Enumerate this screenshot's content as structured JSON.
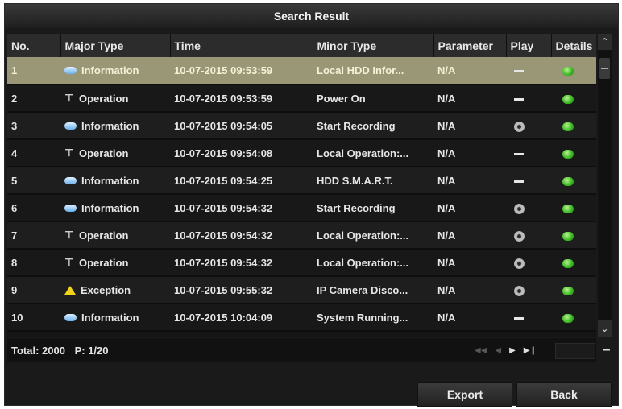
{
  "window": {
    "title": "Search Result"
  },
  "columns": [
    "No.",
    "Major Type",
    "Time",
    "Minor Type",
    "Parameter",
    "Play",
    "Details"
  ],
  "rows": [
    {
      "no": "1",
      "major": "Information",
      "major_icon": "info-cloud-icon",
      "time": "10-07-2015 09:53:59",
      "minor": "Local HDD Infor...",
      "param": "N/A",
      "play": "dash",
      "selected": true
    },
    {
      "no": "2",
      "major": "Operation",
      "major_icon": "operation-icon",
      "time": "10-07-2015 09:53:59",
      "minor": "Power On",
      "param": "N/A",
      "play": "dash",
      "selected": false
    },
    {
      "no": "3",
      "major": "Information",
      "major_icon": "info-cloud-icon",
      "time": "10-07-2015 09:54:05",
      "minor": "Start Recording",
      "param": "N/A",
      "play": "camera",
      "selected": false
    },
    {
      "no": "4",
      "major": "Operation",
      "major_icon": "operation-icon",
      "time": "10-07-2015 09:54:08",
      "minor": "Local Operation:...",
      "param": "N/A",
      "play": "dash",
      "selected": false
    },
    {
      "no": "5",
      "major": "Information",
      "major_icon": "info-cloud-icon",
      "time": "10-07-2015 09:54:25",
      "minor": "HDD S.M.A.R.T.",
      "param": "N/A",
      "play": "dash",
      "selected": false
    },
    {
      "no": "6",
      "major": "Information",
      "major_icon": "info-cloud-icon",
      "time": "10-07-2015 09:54:32",
      "minor": "Start Recording",
      "param": "N/A",
      "play": "camera",
      "selected": false
    },
    {
      "no": "7",
      "major": "Operation",
      "major_icon": "operation-icon",
      "time": "10-07-2015 09:54:32",
      "minor": "Local Operation:...",
      "param": "N/A",
      "play": "camera",
      "selected": false
    },
    {
      "no": "8",
      "major": "Operation",
      "major_icon": "operation-icon",
      "time": "10-07-2015 09:54:32",
      "minor": "Local Operation:...",
      "param": "N/A",
      "play": "camera",
      "selected": false
    },
    {
      "no": "9",
      "major": "Exception",
      "major_icon": "warning-triangle-icon",
      "time": "10-07-2015 09:55:32",
      "minor": "IP Camera Disco...",
      "param": "N/A",
      "play": "camera",
      "selected": false
    },
    {
      "no": "10",
      "major": "Information",
      "major_icon": "info-cloud-icon",
      "time": "10-07-2015 10:04:09",
      "minor": "System Running...",
      "param": "N/A",
      "play": "dash",
      "selected": false
    }
  ],
  "footer": {
    "total": "Total: 2000",
    "page": "P: 1/20"
  },
  "buttons": {
    "export": "Export",
    "back": "Back"
  },
  "colors": {
    "selected_row": "#9a9776",
    "details_dot": "#37b622",
    "exception_icon": "#f2d21a",
    "info_icon": "#6ab0ee"
  }
}
